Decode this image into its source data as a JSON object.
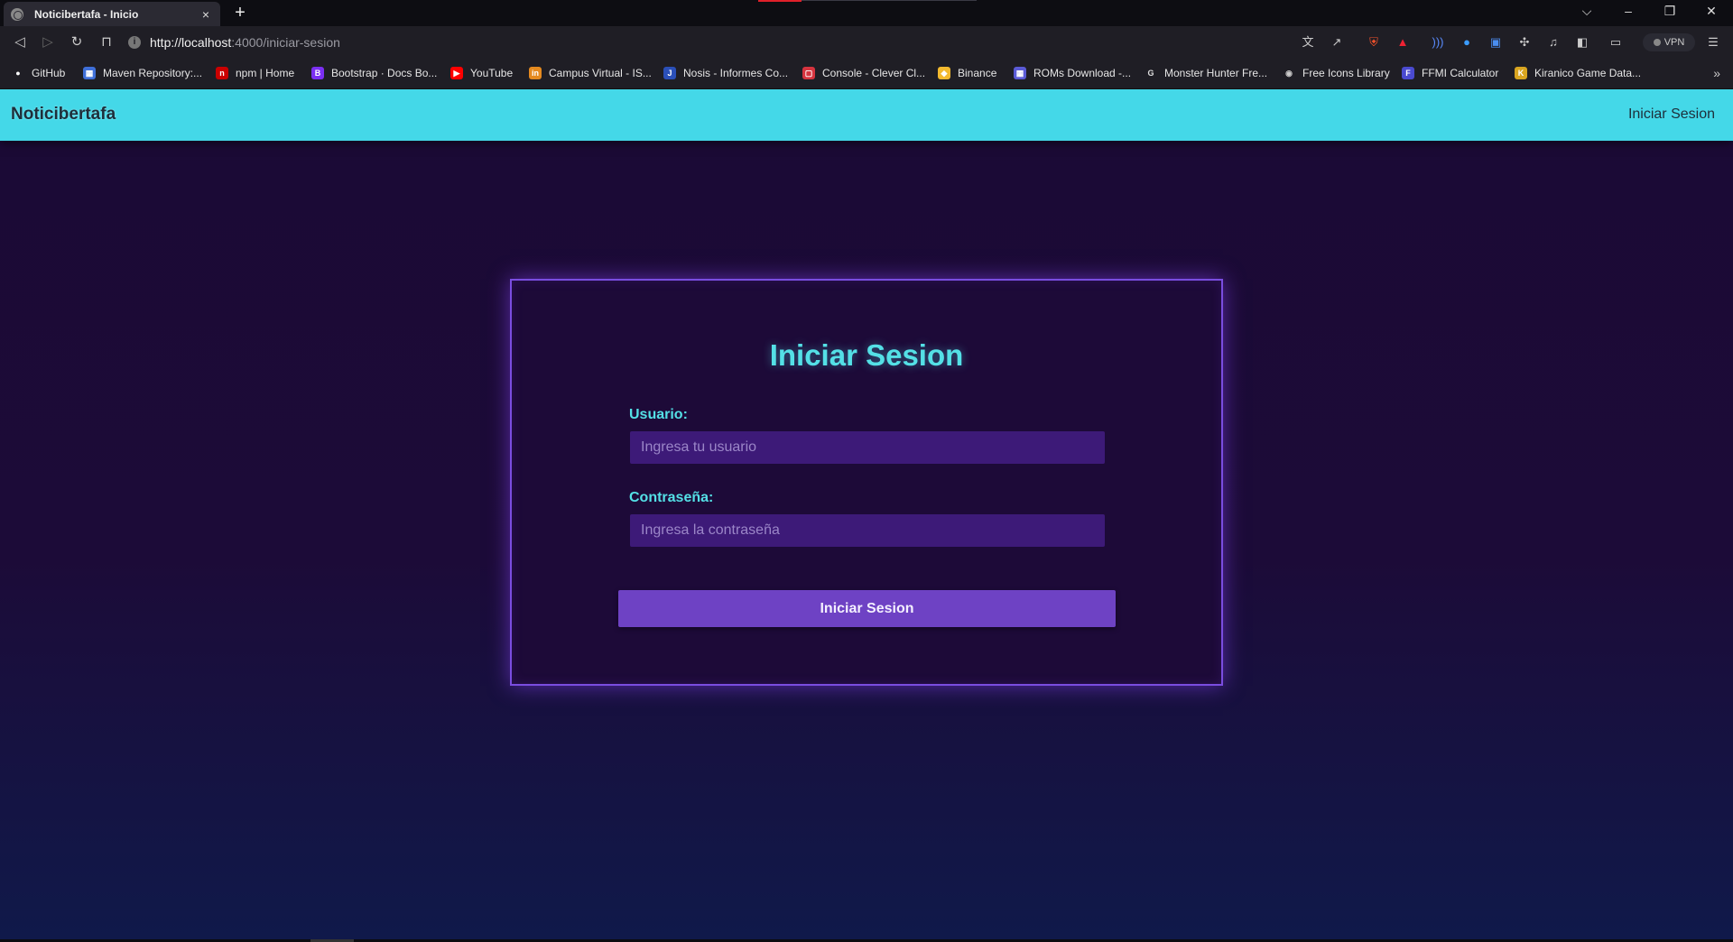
{
  "browser": {
    "tab_title": "Noticibertafa - Inicio",
    "tab_close": "×",
    "new_tab": "+",
    "url_host": "http://localhost",
    "url_path": ":4000/iniciar-sesion",
    "vpn_label": "VPN",
    "bookmarks": [
      {
        "label": "GitHub",
        "icon": "github-icon",
        "color": "#ffffff"
      },
      {
        "label": "Maven Repository:...",
        "icon": "maven-icon",
        "color": "#3f6fd8"
      },
      {
        "label": "npm | Home",
        "icon": "npm-icon",
        "color": "#cb0000"
      },
      {
        "label": "Bootstrap · Docs Bo...",
        "icon": "bootstrap-icon",
        "color": "#7b2ff2"
      },
      {
        "label": "YouTube",
        "icon": "youtube-icon",
        "color": "#ff0000"
      },
      {
        "label": "Campus Virtual - IS...",
        "icon": "campus-icon",
        "color": "#e58a1f"
      },
      {
        "label": "Nosis - Informes Co...",
        "icon": "nosis-icon",
        "color": "#2a4fb8"
      },
      {
        "label": "Console - Clever Cl...",
        "icon": "clever-cloud-icon",
        "color": "#d6343f"
      },
      {
        "label": "Binance",
        "icon": "binance-icon",
        "color": "#f3ba2f"
      },
      {
        "label": "ROMs Download -...",
        "icon": "roms-icon",
        "color": "#5b5bd6"
      },
      {
        "label": "Monster Hunter Fre...",
        "icon": "monster-hunter-icon",
        "color": "#dddddd"
      },
      {
        "label": "Free Icons Library",
        "icon": "globe-icon",
        "color": "#cccccc"
      },
      {
        "label": "FFMI Calculator",
        "icon": "ffmi-icon",
        "color": "#4a4ad0"
      },
      {
        "label": "Kiranico Game Data...",
        "icon": "kiranico-icon",
        "color": "#d9a520"
      }
    ]
  },
  "app": {
    "brand": "Noticibertafa",
    "header_link": "Iniciar Sesion"
  },
  "login": {
    "title": "Iniciar Sesion",
    "username_label": "Usuario:",
    "username_placeholder": "Ingresa tu usuario",
    "username_value": "",
    "password_label": "Contraseña:",
    "password_placeholder": "Ingresa la contraseña",
    "password_value": "",
    "submit_label": "Iniciar Sesion"
  },
  "colors": {
    "header_bg": "#44d8e8",
    "accent_cyan": "#54e0e6",
    "card_border": "#7a4de0",
    "button_bg": "#6e42c4",
    "input_bg": "#3d1a78",
    "page_bg": "#1b0a35"
  }
}
